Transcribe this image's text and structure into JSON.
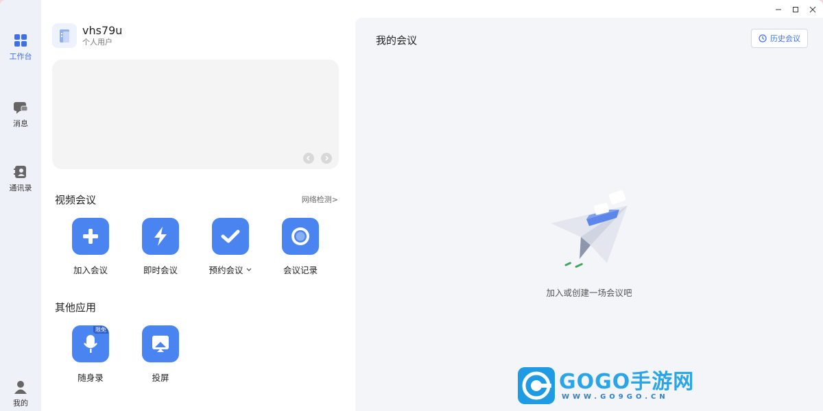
{
  "rail": {
    "items": [
      {
        "label": "工作台",
        "icon": "grid-icon",
        "active": true
      },
      {
        "label": "消息",
        "icon": "chat-icon"
      },
      {
        "label": "通讯录",
        "icon": "contacts-icon"
      }
    ],
    "profile_label": "我的"
  },
  "user": {
    "name": "vhs79u",
    "type": "个人用户"
  },
  "video": {
    "title": "视频会议",
    "network_check": "网络检测>",
    "actions": [
      {
        "label": "加入会议",
        "icon": "plus-icon"
      },
      {
        "label": "即时会议",
        "icon": "lightning-icon"
      },
      {
        "label": "预约会议",
        "icon": "check-icon",
        "dropdown": true
      },
      {
        "label": "会议记录",
        "icon": "record-icon"
      }
    ]
  },
  "other": {
    "title": "其他应用",
    "apps": [
      {
        "label": "随身录",
        "icon": "microphone-icon",
        "badge": "限免"
      },
      {
        "label": "投屏",
        "icon": "screen-cast-icon"
      }
    ]
  },
  "meetings": {
    "title": "我的会议",
    "history_button": "历史会议",
    "empty_text": "加入或创建一场会议吧"
  },
  "watermark": {
    "main": "GOGO手游网",
    "sub": "WWW.GO9GO.CN"
  },
  "colors": {
    "accent": "#4a84f0",
    "rail_bg": "#eef1f7",
    "panel_bg": "#f4f5f8"
  }
}
